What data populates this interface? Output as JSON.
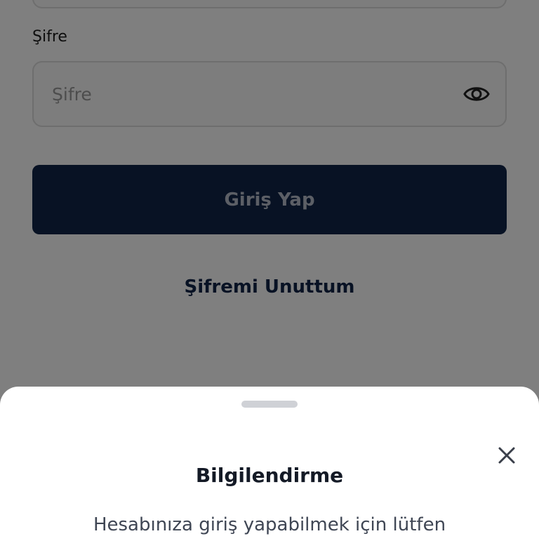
{
  "form": {
    "password_label": "Şifre",
    "password_placeholder": "Şifre",
    "password_value": "",
    "toggle_visibility_icon": "eye-icon",
    "login_button_label": "Giriş Yap",
    "forgot_password_label": "Şifremi Unuttum"
  },
  "sheet": {
    "title": "Bilgilendirme",
    "message": "Hesabınıza giriş yapabilmek için lütfen",
    "close_icon": "close-icon"
  },
  "colors": {
    "primary": "#102548",
    "overlay": "rgba(0,0,0,0.5)",
    "sheet_background": "#ffffff",
    "handle": "#cfd1d6"
  }
}
